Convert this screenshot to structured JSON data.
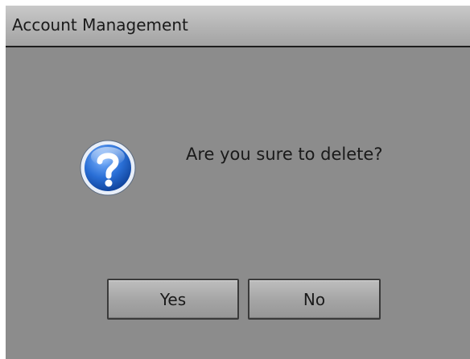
{
  "dialog": {
    "title": "Account Management",
    "message": "Are you sure to delete?",
    "icon": "question-icon",
    "buttons": {
      "yes_label": "Yes",
      "no_label": "No"
    }
  },
  "colors": {
    "dialog_background": "#8c8c8c",
    "icon_blue": "#2a6fd6"
  }
}
